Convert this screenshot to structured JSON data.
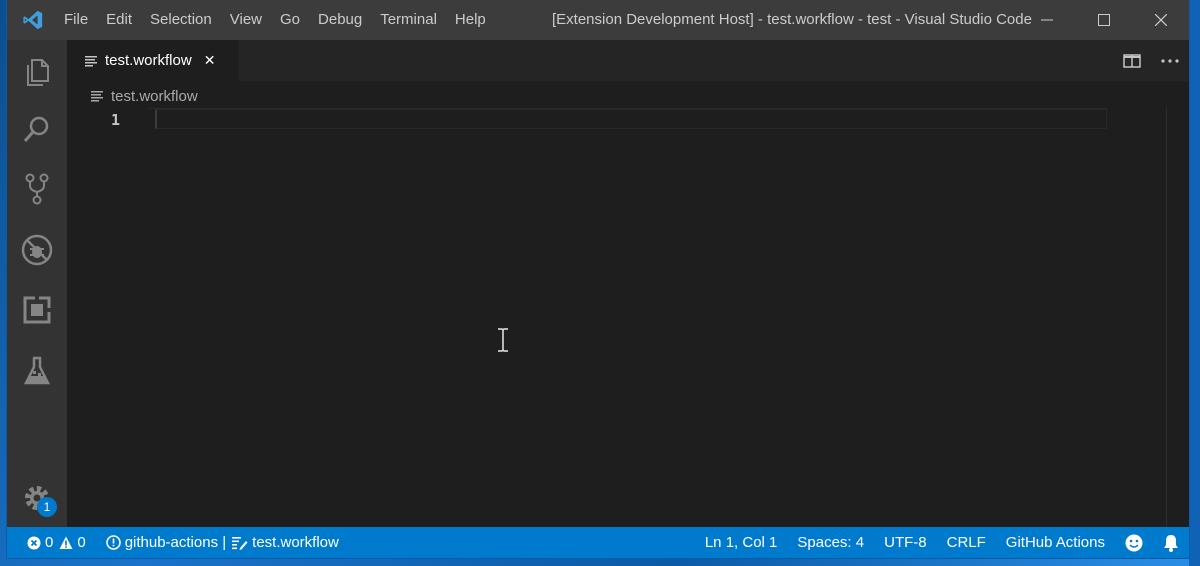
{
  "titlebar": {
    "menu": [
      "File",
      "Edit",
      "Selection",
      "View",
      "Go",
      "Debug",
      "Terminal",
      "Help"
    ],
    "window_title": "[Extension Development Host] - test.workflow - test - Visual Studio Code",
    "controls": [
      "minimize-icon",
      "maximize-icon",
      "close-icon"
    ]
  },
  "activitybar": {
    "items": [
      "explorer-icon",
      "search-icon",
      "source-control-icon",
      "debug-icon",
      "extensions-icon",
      "test-flask-icon"
    ],
    "manage_badge": "1"
  },
  "tabs": [
    {
      "label": "test.workflow",
      "active": true
    }
  ],
  "breadcrumb": {
    "file": "test.workflow"
  },
  "editor": {
    "line_numbers": [
      "1"
    ],
    "lines": [
      ""
    ]
  },
  "statusbar": {
    "errors": "0",
    "warnings": "0",
    "github_label": "github-actions |",
    "file_label": "test.workflow",
    "position": "Ln 1, Col 1",
    "spaces": "Spaces: 4",
    "encoding": "UTF-8",
    "eol": "CRLF",
    "language": "GitHub Actions"
  },
  "colors": {
    "titlebar": "#3c3c3c",
    "activitybar": "#333333",
    "editor_bg": "#1e1e1e",
    "statusbar": "#007acc",
    "accent": "#007acc"
  }
}
